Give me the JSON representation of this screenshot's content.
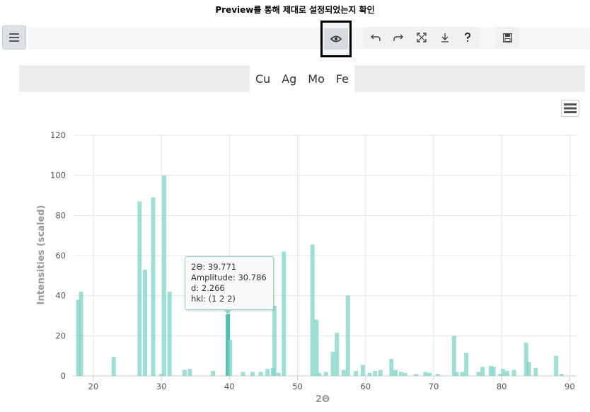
{
  "caption": "Preview를 통해 제대로 설정되었는지 확인",
  "toolbar": {
    "buttons": [
      {
        "name": "undo-icon",
        "glyph": "↶"
      },
      {
        "name": "redo-icon",
        "glyph": "↷"
      },
      {
        "name": "fullscreen-icon",
        "glyph": "⤢"
      },
      {
        "name": "download-icon",
        "glyph": "⤓"
      },
      {
        "name": "help-icon",
        "glyph": "?"
      },
      {
        "name": "save-icon",
        "glyph": "💾"
      }
    ]
  },
  "targets": [
    "Cu",
    "Ag",
    "Mo",
    "Fe"
  ],
  "tooltip": {
    "line1": "2Θ: 39.771",
    "line2": "Amplitude: 30.786",
    "line3": "d: 2.266",
    "line4": "hkl: (1 2 2)"
  },
  "colors": {
    "bar": "#7dd3c7",
    "bar_dark": "#3fb8a8"
  },
  "chart_data": {
    "type": "bar",
    "xlabel": "2Θ",
    "ylabel": "Intensities (scaled)",
    "xlim": [
      17,
      91
    ],
    "ylim": [
      0,
      120
    ],
    "xticks": [
      20,
      30,
      40,
      50,
      60,
      70,
      80,
      90
    ],
    "yticks": [
      0,
      20,
      40,
      60,
      80,
      100,
      120
    ],
    "grid": true,
    "bars": [
      [
        17.8,
        38
      ],
      [
        18.2,
        42
      ],
      [
        23.0,
        9.5
      ],
      [
        26.8,
        87
      ],
      [
        27.6,
        53
      ],
      [
        28.8,
        89
      ],
      [
        30.0,
        1
      ],
      [
        30.4,
        100
      ],
      [
        31.2,
        42
      ],
      [
        33.4,
        3
      ],
      [
        34.2,
        3.5
      ],
      [
        37.6,
        2.5
      ],
      [
        39.77,
        30.8
      ],
      [
        40.1,
        18
      ],
      [
        42.0,
        2
      ],
      [
        43.4,
        2
      ],
      [
        44.6,
        2
      ],
      [
        45.6,
        3.5
      ],
      [
        46.4,
        4
      ],
      [
        46.6,
        35
      ],
      [
        47.2,
        1.5
      ],
      [
        48.0,
        62
      ],
      [
        52.2,
        65.5
      ],
      [
        52.8,
        28
      ],
      [
        53.2,
        1.5
      ],
      [
        54.2,
        2
      ],
      [
        55.2,
        12
      ],
      [
        55.8,
        21.5
      ],
      [
        56.8,
        3
      ],
      [
        57.4,
        40
      ],
      [
        58.6,
        2.5
      ],
      [
        59.6,
        5.5
      ],
      [
        60.6,
        1.5
      ],
      [
        61.4,
        2.5
      ],
      [
        62.2,
        3
      ],
      [
        63.8,
        8.5
      ],
      [
        64.4,
        3
      ],
      [
        65.2,
        2
      ],
      [
        65.8,
        1.5
      ],
      [
        67.4,
        1
      ],
      [
        68.8,
        2
      ],
      [
        69.4,
        1.5
      ],
      [
        70.6,
        1
      ],
      [
        73.0,
        20
      ],
      [
        73.4,
        2
      ],
      [
        74.2,
        2
      ],
      [
        74.8,
        11.5
      ],
      [
        76.6,
        2
      ],
      [
        77.2,
        4.5
      ],
      [
        78.4,
        5
      ],
      [
        78.8,
        4.5
      ],
      [
        79.8,
        1
      ],
      [
        80.2,
        3.5
      ],
      [
        80.8,
        2.5
      ],
      [
        81.8,
        3
      ],
      [
        83.6,
        16.5
      ],
      [
        84.0,
        7
      ],
      [
        85.0,
        4
      ],
      [
        88.0,
        10
      ],
      [
        88.8,
        1
      ]
    ],
    "hover_x": 39.771
  }
}
